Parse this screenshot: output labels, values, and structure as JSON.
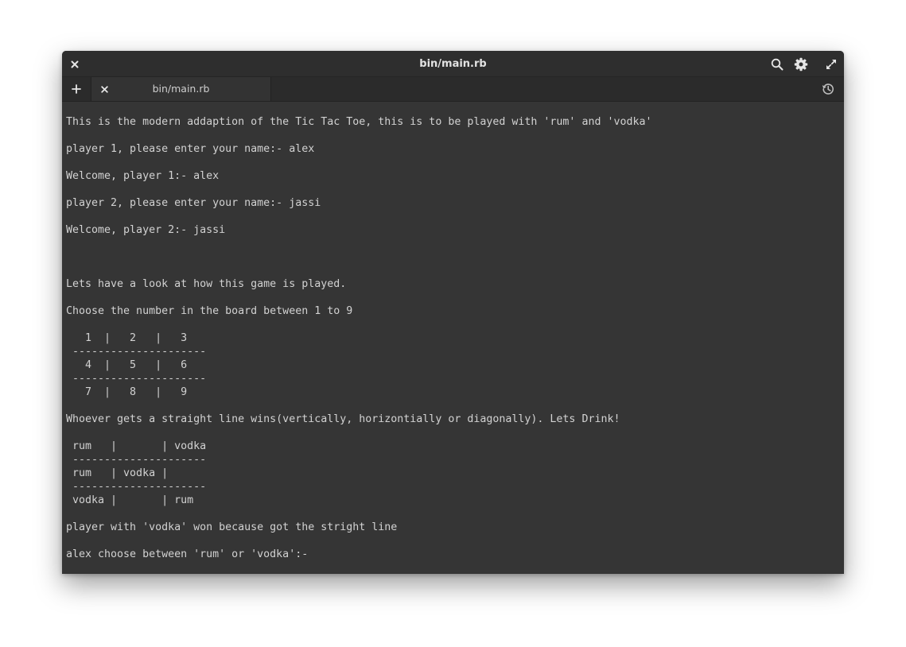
{
  "window": {
    "title": "bin/main.rb",
    "icons": {
      "close": "close-icon",
      "search": "search-icon",
      "settings": "gear-icon",
      "maximize": "maximize-icon"
    }
  },
  "tabs": {
    "add_icon": "plus-icon",
    "history_icon": "history-icon",
    "items": [
      {
        "label": "bin/main.rb",
        "active": true
      }
    ]
  },
  "terminal": {
    "lines": [
      "This is the modern addaption of the Tic Tac Toe, this is to be played with 'rum' and 'vodka'",
      "",
      "player 1, please enter your name:- alex",
      "",
      "Welcome, player 1:- alex",
      "",
      "player 2, please enter your name:- jassi",
      "",
      "Welcome, player 2:- jassi",
      "",
      "",
      "",
      "Lets have a look at how this game is played.",
      "",
      "Choose the number in the board between 1 to 9",
      "",
      "   1  |   2   |   3",
      " ---------------------",
      "   4  |   5   |   6",
      " ---------------------",
      "   7  |   8   |   9",
      "",
      "Whoever gets a straight line wins(vertically, horizontially or diagonally). Lets Drink!",
      "",
      " rum   |       | vodka",
      " ---------------------",
      " rum   | vodka |",
      " ---------------------",
      " vodka |       | rum",
      "",
      "player with 'vodka' won because got the stright line",
      "",
      "alex choose between 'rum' or 'vodka':-"
    ]
  },
  "colors": {
    "window_bg": "#353535",
    "titlebar_bg": "#2e2e2e",
    "tabbar_bg": "#2b2b2b",
    "text": "#d2d2d2",
    "icon": "#e6e6e6"
  }
}
